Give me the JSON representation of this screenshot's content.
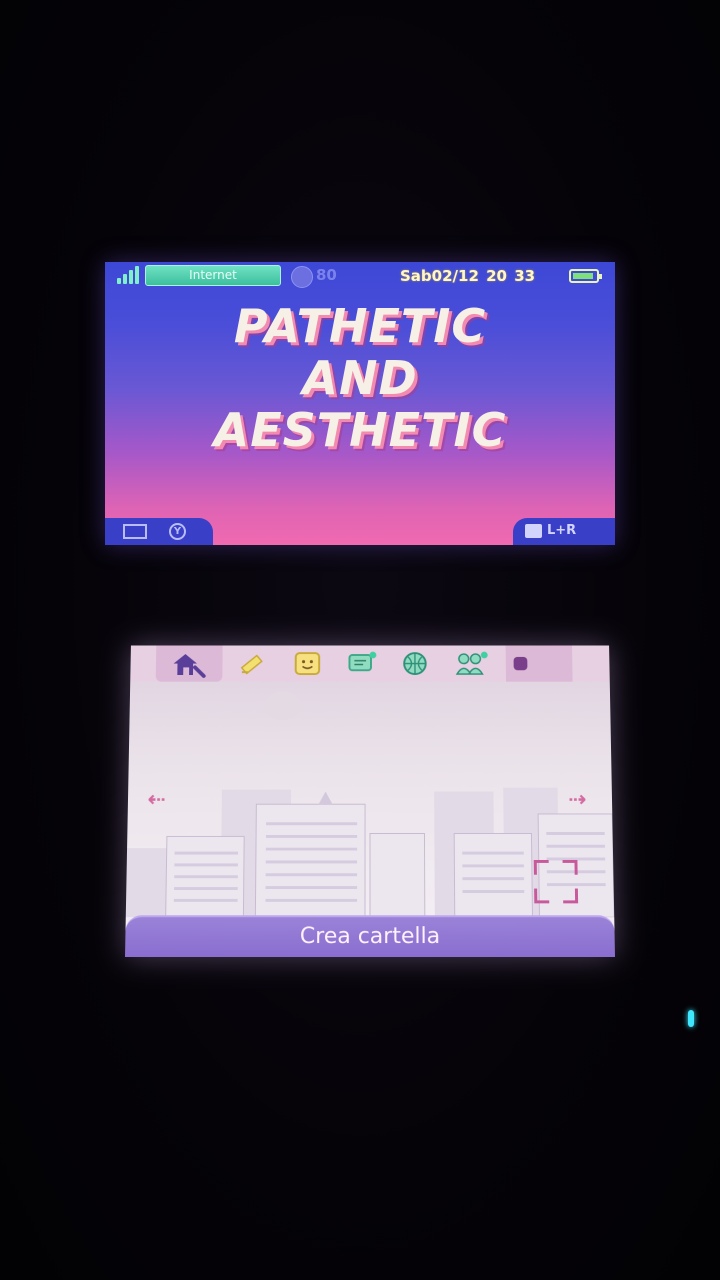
{
  "top_screen": {
    "connection_label": "Internet",
    "coin_count": "80",
    "date_time": "Sab02/12 20 33",
    "headline": [
      "PATHETIC",
      "AND",
      "AESTHETIC"
    ],
    "lr_label": "L+R"
  },
  "bottom_screen": {
    "action_label": "Crea cartella",
    "menu_icons": [
      "home-settings-icon",
      "game-notes-icon",
      "friend-list-icon",
      "notifications-icon",
      "internet-browser-icon",
      "miiverse-icon"
    ],
    "accent_color": "#d46aa0"
  }
}
